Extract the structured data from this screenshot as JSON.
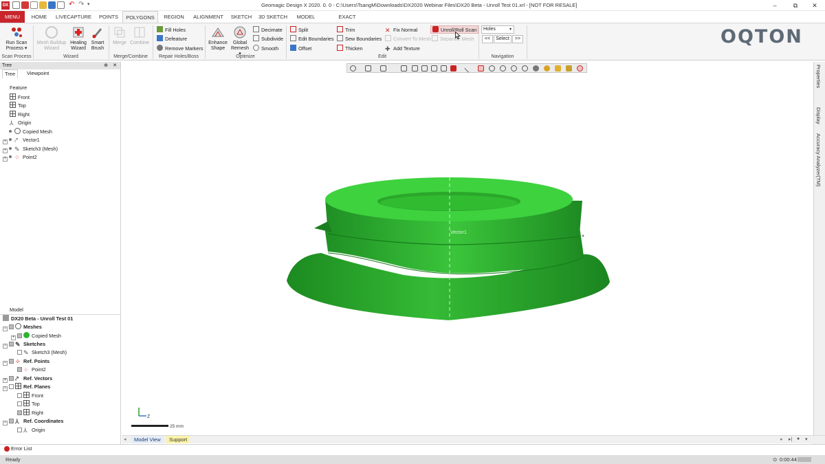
{
  "window": {
    "title": "Geomagic Design X 2020. 0. 0 - C:\\Users\\TsangM\\Downloads\\DX2020 Webinar Files\\DX20 Beta - Unroll Test 01.xrl - [NOT FOR RESALE]",
    "app_icon": "DX",
    "minimize": "–",
    "maximize": "⧉",
    "close": "✕"
  },
  "tabs": [
    "MENU",
    "HOME",
    "LIVECAPTURE",
    "POINTS",
    "POLYGONS",
    "REGION",
    "ALIGNMENT",
    "SKETCH",
    "3D SKETCH",
    "MODEL",
    "EXACT SURFACING"
  ],
  "ribbon": {
    "groups": {
      "scan": "Scan Process",
      "wizard": "Wizard",
      "merge": "Merge/Combine",
      "repair": "Repair Holes/Boss",
      "optimize": "Optimize",
      "edit": "Edit",
      "navigation": "Navigation"
    },
    "run_scan": [
      "Run Scan",
      "Process ▾"
    ],
    "mesh_buildup": [
      "Mesh Buildup",
      "Wizard"
    ],
    "healing": [
      "Healing",
      "Wizard"
    ],
    "smart_brush": [
      "Smart",
      "Brush"
    ],
    "merge": "Merge",
    "combine": "Combine",
    "fill_holes": "Fill Holes",
    "defeature": "Defeature",
    "remove_markers": "Remove Markers",
    "enhance_shape": [
      "Enhance",
      "Shape"
    ],
    "global_remesh": [
      "Global",
      "Remesh ▾"
    ],
    "decimate": "Decimate",
    "subdivide": "Subdivide",
    "smooth": "Smooth",
    "split": "Split",
    "edit_boundaries": "Edit Boundaries",
    "offset": "Offset",
    "trim": "Trim",
    "sew_boundaries": "Sew Boundaries",
    "thicken": "Thicken",
    "fix_normal": "Fix Normal",
    "convert_to_mesh": "Convert To Mesh",
    "add_texture": "Add Texture",
    "unroll_roll_scan": "Unroll/Roll Scan",
    "separate_mesh": "Separate Mesh",
    "holes_select": "Holes",
    "nav_prev": "<<",
    "nav_select": "Select",
    "nav_next": ">>"
  },
  "logo": "OQTON",
  "tree_panel": {
    "header": "Tree",
    "tabs": [
      "Tree",
      "Viewpoint"
    ],
    "feature_label": "Feature",
    "features": [
      "Front",
      "Top",
      "Right",
      "Origin",
      "Copied Mesh",
      "Vector1",
      "Sketch3 (Mesh)",
      "Point2"
    ],
    "model_label": "Model",
    "model_root": "DX20 Beta - Unroll Test 01",
    "model_items": [
      "Meshes",
      "Copied Mesh",
      "Sketches",
      "Sketch3 (Mesh)",
      "Ref. Points",
      "Point2",
      "Ref. Vectors",
      "Ref. Planes",
      "Front",
      "Top",
      "Right",
      "Ref. Coordinates",
      "Origin"
    ]
  },
  "viewport": {
    "vector_label": "Vector1",
    "scale_label": "25 mm",
    "axis_label": "Z",
    "model_color": "#2fb32f"
  },
  "right_tabs": [
    "Properties",
    "Display",
    "Accuracy Analyzer(TM)"
  ],
  "view_tabs": [
    "Model View",
    "Support"
  ],
  "error_list": "Error List",
  "status": {
    "left": "Ready",
    "right": "0:00:44"
  }
}
